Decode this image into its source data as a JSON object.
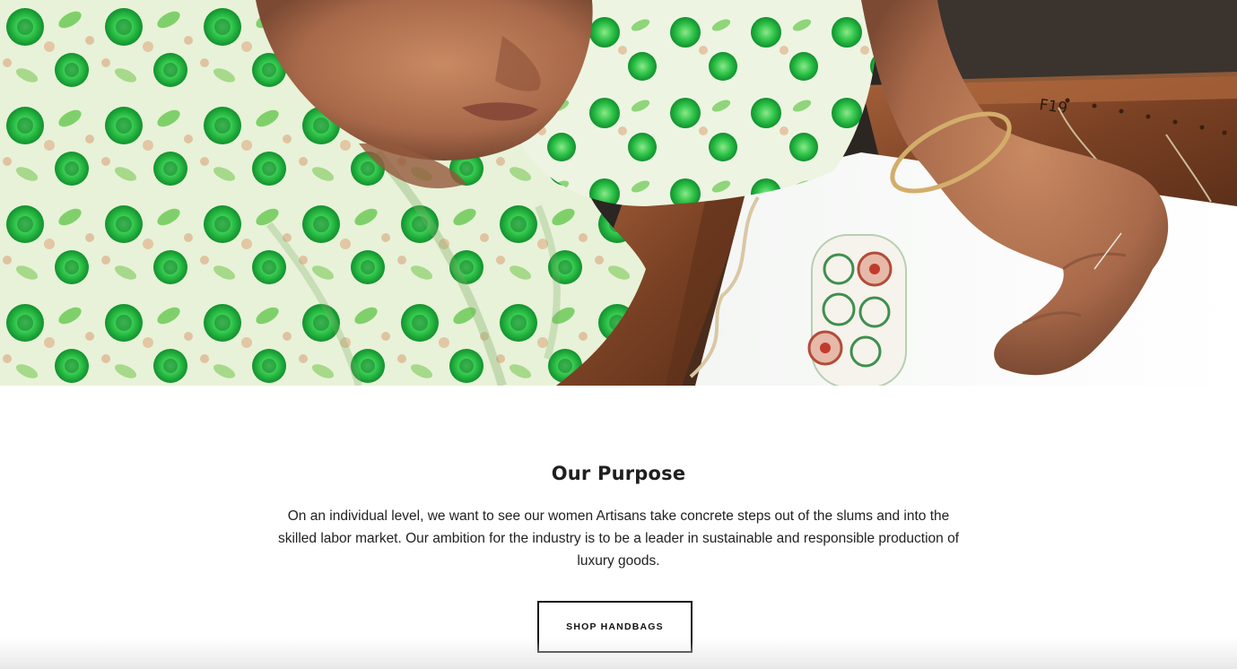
{
  "hero": {
    "image_subject": "woman-artisan-embroidering-photo",
    "frame_label": "F19"
  },
  "purpose": {
    "title": "Our Purpose",
    "body": "On an individual level, we want to see our women Artisans take concrete steps out of the slums and into the skilled labor market. Our ambition for the industry is to be a leader in sustainable and responsible production of luxury goods.",
    "cta_label": "SHOP HANDBAGS"
  },
  "colors": {
    "text": "#222222",
    "button_border": "#111111",
    "background": "#ffffff"
  }
}
